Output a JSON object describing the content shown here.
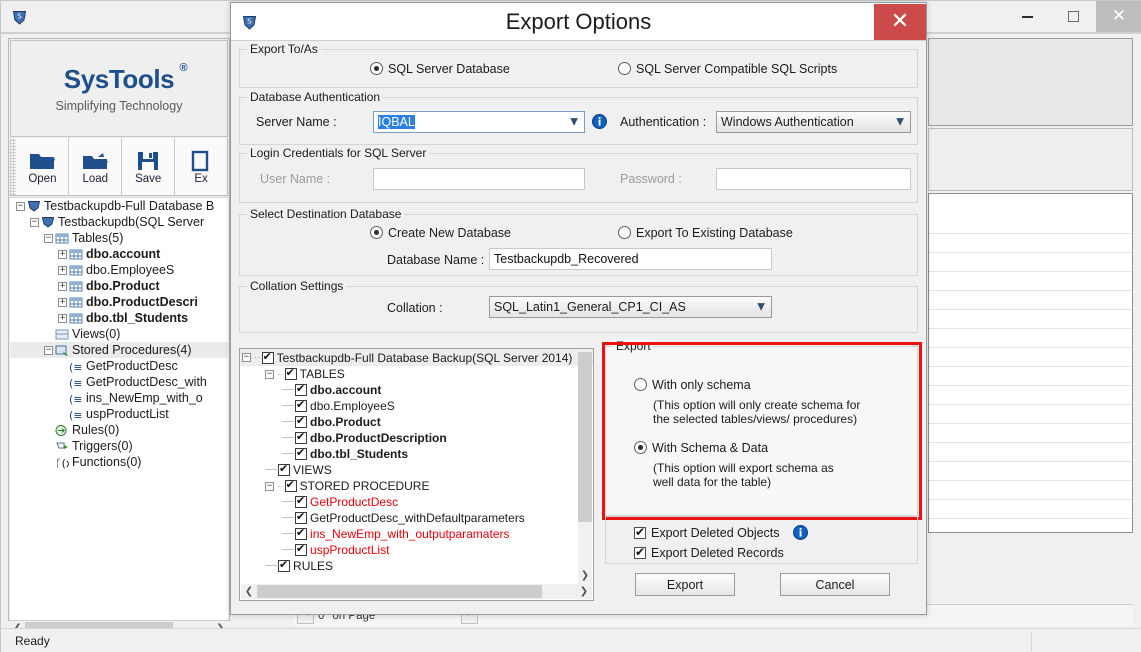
{
  "main_window": {
    "app_icon": "shield-icon",
    "minimize": "minimize-icon",
    "maximize": "maximize-icon",
    "close": "close-icon",
    "logo": {
      "name": "SysTools",
      "registered": "®",
      "tagline": "Simplifying Technology"
    },
    "toolbar": [
      {
        "label": "Open",
        "icon": "open-folder-icon"
      },
      {
        "label": "Load",
        "icon": "load-folder-icon"
      },
      {
        "label": "Save",
        "icon": "save-disk-icon"
      },
      {
        "label": "Ex",
        "icon": "export-icon"
      }
    ],
    "tree": [
      {
        "label": "Testbackupdb-Full Database B",
        "indent": 0,
        "expander": "-",
        "icon": "shield-icon",
        "bold": false,
        "red": false
      },
      {
        "label": "Testbackupdb(SQL Server ",
        "indent": 1,
        "expander": "-",
        "icon": "shield-icon",
        "bold": false,
        "red": false
      },
      {
        "label": "Tables(5)",
        "indent": 2,
        "expander": "-",
        "icon": "table-icon",
        "bold": false,
        "red": false
      },
      {
        "label": "dbo.account",
        "indent": 3,
        "expander": "+",
        "icon": "table-icon",
        "bold": true,
        "red": false
      },
      {
        "label": "dbo.EmployeeS",
        "indent": 3,
        "expander": "+",
        "icon": "table-icon",
        "bold": false,
        "red": false
      },
      {
        "label": "dbo.Product",
        "indent": 3,
        "expander": "+",
        "icon": "table-icon",
        "bold": true,
        "red": false
      },
      {
        "label": "dbo.ProductDescri",
        "indent": 3,
        "expander": "+",
        "icon": "table-icon",
        "bold": true,
        "red": false
      },
      {
        "label": "dbo.tbl_Students",
        "indent": 3,
        "expander": "+",
        "icon": "table-icon",
        "bold": true,
        "red": false
      },
      {
        "label": "Views(0)",
        "indent": 2,
        "expander": "",
        "icon": "view-icon",
        "bold": false,
        "red": false
      },
      {
        "label": "Stored Procedures(4)",
        "indent": 2,
        "expander": "-",
        "icon": "procedure-icon",
        "bold": false,
        "red": false,
        "highlight": true
      },
      {
        "label": "GetProductDesc",
        "indent": 3,
        "expander": "",
        "icon": "sp-icon",
        "bold": false,
        "red": true
      },
      {
        "label": "GetProductDesc_with",
        "indent": 3,
        "expander": "",
        "icon": "sp-icon",
        "bold": false,
        "red": false
      },
      {
        "label": "ins_NewEmp_with_o",
        "indent": 3,
        "expander": "",
        "icon": "sp-icon",
        "bold": false,
        "red": true
      },
      {
        "label": "uspProductList",
        "indent": 3,
        "expander": "",
        "icon": "sp-icon",
        "bold": false,
        "red": true
      },
      {
        "label": "Rules(0)",
        "indent": 2,
        "expander": "",
        "icon": "rules-icon",
        "bold": false,
        "red": false
      },
      {
        "label": "Triggers(0)",
        "indent": 2,
        "expander": "",
        "icon": "trigger-icon",
        "bold": false,
        "red": false
      },
      {
        "label": "Functions(0)",
        "indent": 2,
        "expander": "",
        "icon": "function-icon",
        "bold": false,
        "red": false
      }
    ],
    "pager": {
      "page_value": "0",
      "page_label": "on Page",
      "prev": "<",
      "next": ">"
    },
    "status": "Ready"
  },
  "dialog": {
    "title": "Export Options",
    "icon": "shield-icon",
    "close_label": "✕",
    "export_to_as": {
      "legend": "Export To/As",
      "options": [
        {
          "label": "SQL Server Database",
          "selected": true
        },
        {
          "label": "SQL Server Compatible SQL Scripts",
          "selected": false
        }
      ]
    },
    "database_auth": {
      "legend": "Database Authentication",
      "server_name_label": "Server Name :",
      "server_name_value": "IQBAL",
      "info_icon": "info-icon",
      "authentication_label": "Authentication :",
      "authentication_value": "Windows Authentication"
    },
    "login_credentials": {
      "legend": "Login Credentials for SQL Server",
      "user_name_label": "User Name :",
      "user_name_value": "",
      "password_label": "Password :",
      "password_value": ""
    },
    "destination": {
      "legend": "Select Destination Database",
      "options": [
        {
          "label": "Create New Database",
          "selected": true
        },
        {
          "label": "Export To Existing Database",
          "selected": false
        }
      ],
      "database_name_label": "Database Name :",
      "database_name_value": "Testbackupdb_Recovered"
    },
    "collation": {
      "legend": "Collation Settings",
      "label": "Collation :",
      "value": "SQL_Latin1_General_CP1_CI_AS"
    },
    "object_tree": {
      "root": "Testbackupdb-Full Database Backup(SQL Server 2014)",
      "items": [
        {
          "label": "TABLES",
          "indent": 1,
          "expander": "-",
          "checked": true,
          "bold": false,
          "red": false
        },
        {
          "label": "dbo.account",
          "indent": 2,
          "expander": "",
          "checked": true,
          "bold": true,
          "red": false
        },
        {
          "label": "dbo.EmployeeS",
          "indent": 2,
          "expander": "",
          "checked": true,
          "bold": false,
          "red": false
        },
        {
          "label": "dbo.Product",
          "indent": 2,
          "expander": "",
          "checked": true,
          "bold": true,
          "red": false
        },
        {
          "label": "dbo.ProductDescription",
          "indent": 2,
          "expander": "",
          "checked": true,
          "bold": true,
          "red": false
        },
        {
          "label": "dbo.tbl_Students",
          "indent": 2,
          "expander": "",
          "checked": true,
          "bold": true,
          "red": false
        },
        {
          "label": "VIEWS",
          "indent": 1,
          "expander": "",
          "checked": true,
          "bold": false,
          "red": false
        },
        {
          "label": "STORED PROCEDURE",
          "indent": 1,
          "expander": "-",
          "checked": true,
          "bold": false,
          "red": false
        },
        {
          "label": "GetProductDesc",
          "indent": 2,
          "expander": "",
          "checked": true,
          "bold": false,
          "red": true
        },
        {
          "label": "GetProductDesc_withDefaultparameters",
          "indent": 2,
          "expander": "",
          "checked": true,
          "bold": false,
          "red": false
        },
        {
          "label": "ins_NewEmp_with_outputparamaters",
          "indent": 2,
          "expander": "",
          "checked": true,
          "bold": false,
          "red": true
        },
        {
          "label": "uspProductList",
          "indent": 2,
          "expander": "",
          "checked": true,
          "bold": false,
          "red": true
        },
        {
          "label": "RULES",
          "indent": 1,
          "expander": "",
          "checked": true,
          "bold": false,
          "red": false
        }
      ]
    },
    "export_group": {
      "legend": "Export",
      "options": [
        {
          "label": "With only schema",
          "selected": false,
          "note": "(This option will only create schema for\nthe  selected tables/views/ procedures)"
        },
        {
          "label": "With Schema & Data",
          "selected": true,
          "note": "(This option will export schema as\nwell data for the table)"
        }
      ],
      "highlight_color": "#ee1111"
    },
    "deleted_options": [
      {
        "label": "Export Deleted Objects",
        "checked": true,
        "info_icon": "info-icon"
      },
      {
        "label": "Export Deleted Records",
        "checked": true,
        "info_icon": null
      }
    ],
    "buttons": {
      "export": "Export",
      "cancel": "Cancel"
    }
  }
}
